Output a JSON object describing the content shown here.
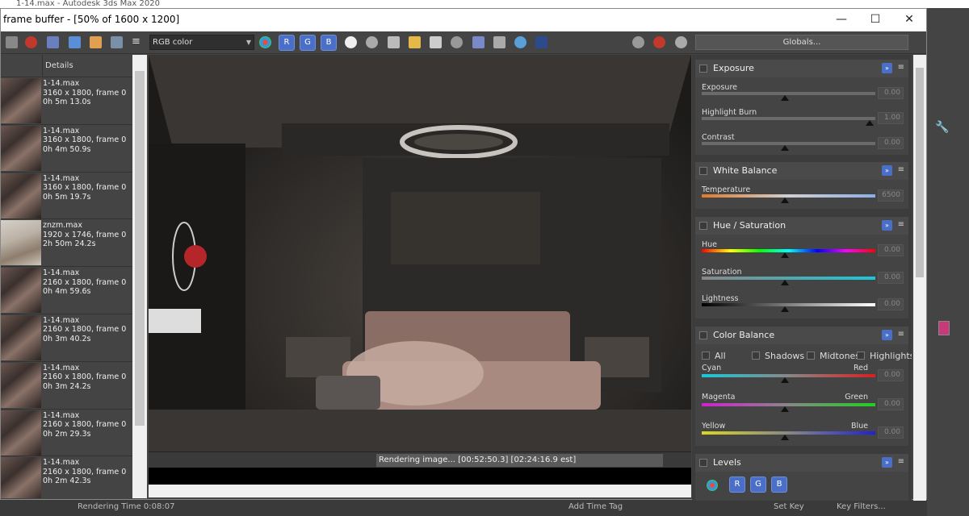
{
  "background_app": {
    "title": "1-14.max - Autodesk 3ds Max 2020",
    "status_left": "Rendering Time  0:08:07",
    "status_mid": "Add Time Tag",
    "status_btn1": "Set Key",
    "status_btn2": "Key Filters..."
  },
  "window": {
    "title": "frame buffer - [50% of 1600 x 1200]",
    "controls": [
      "—",
      "☐",
      "✕"
    ]
  },
  "toolbar": {
    "channel_select": "RGB color",
    "channel_r": "R",
    "channel_g": "G",
    "channel_b": "B",
    "globals_button": "Globals..."
  },
  "history": {
    "header": "Details",
    "items": [
      {
        "name": "1-14.max",
        "resolution": "3160 x 1800, frame 0",
        "time": "0h 5m 13.0s",
        "light": false
      },
      {
        "name": "1-14.max",
        "resolution": "3160 x 1800, frame 0",
        "time": "0h 4m 50.9s",
        "light": false
      },
      {
        "name": "1-14.max",
        "resolution": "3160 x 1800, frame 0",
        "time": "0h 5m 19.7s",
        "light": false
      },
      {
        "name": "znzm.max",
        "resolution": "1920 x 1746, frame 0",
        "time": "2h 50m 24.2s",
        "light": true
      },
      {
        "name": "1-14.max",
        "resolution": "2160 x 1800, frame 0",
        "time": "0h 4m 59.6s",
        "light": false
      },
      {
        "name": "1-14.max",
        "resolution": "2160 x 1800, frame 0",
        "time": "0h 3m 40.2s",
        "light": false
      },
      {
        "name": "1-14.max",
        "resolution": "2160 x 1800, frame 0",
        "time": "0h 3m 24.2s",
        "light": false
      },
      {
        "name": "1-14.max",
        "resolution": "2160 x 1800, frame 0",
        "time": "0h 2m 29.3s",
        "light": false
      },
      {
        "name": "1-14.max",
        "resolution": "2160 x 1800, frame 0",
        "time": "0h 2m 42.3s",
        "light": false
      }
    ]
  },
  "status": {
    "progress_text": "Rendering image... [00:52:50.3] [02:24:16.9 est]"
  },
  "corrections": {
    "exposure": {
      "title": "Exposure",
      "exposure_label": "Exposure",
      "exposure_value": "0.00",
      "burn_label": "Highlight Burn",
      "burn_value": "1.00",
      "contrast_label": "Contrast",
      "contrast_value": "0.00"
    },
    "white_balance": {
      "title": "White Balance",
      "temperature_label": "Temperature",
      "temperature_value": "6500"
    },
    "hue_saturation": {
      "title": "Hue / Saturation",
      "hue_label": "Hue",
      "hue_value": "0.00",
      "saturation_label": "Saturation",
      "saturation_value": "0.00",
      "lightness_label": "Lightness",
      "lightness_value": "0.00"
    },
    "color_balance": {
      "title": "Color Balance",
      "all_label": "All",
      "shadows_label": "Shadows",
      "midtones_label": "Midtones",
      "highlights_label": "Highlights",
      "cyan_label": "Cyan",
      "red_label": "Red",
      "cr_value": "0.00",
      "magenta_label": "Magenta",
      "green_label": "Green",
      "mg_value": "0.00",
      "yellow_label": "Yellow",
      "blue_label": "Blue",
      "yb_value": "0.00"
    },
    "levels": {
      "title": "Levels",
      "r": "R",
      "g": "G",
      "b": "B"
    }
  }
}
